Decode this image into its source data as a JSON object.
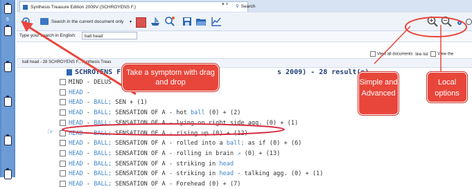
{
  "sidebar": {
    "count": "6"
  },
  "tabs": [
    {
      "label": "Synthesis Treasure Edition 2009V (SCHROYENS F.)",
      "controls": "▾ ×"
    },
    {
      "label": "Search"
    }
  ],
  "toolbar": {
    "search_scope": "Search in the current document only",
    "search_prompt": "Type your search in English:",
    "search_value": "ball head",
    "option_view_all": "View all documents",
    "option_view_list": "line list",
    "option_view_the": "View the"
  },
  "breadcrumb": "ball head - 28  SCHROYENS F., Synthesis Treas",
  "result_header": {
    "prefix": "SCHROYENS F",
    "suffix": "s 2009) - 28 result(s)"
  },
  "results": [
    {
      "parts": [
        [
          "MIND - DELUS",
          ""
        ]
      ]
    },
    {
      "parts": [
        [
          "HEAD",
          "kw"
        ],
        [
          " - ",
          ""
        ]
      ]
    },
    {
      "parts": [
        [
          "HEAD",
          "kw"
        ],
        [
          " - ",
          ""
        ],
        [
          "BALL;",
          "kw"
        ],
        [
          " SEN",
          ""
        ],
        [
          "                        + (1)",
          ""
        ]
      ]
    },
    {
      "parts": [
        [
          "HEAD",
          "kw"
        ],
        [
          " - ",
          ""
        ],
        [
          "BALL;",
          "kw"
        ],
        [
          " SENSATION OF A - hot ",
          ""
        ],
        [
          "ball",
          "kw"
        ],
        [
          " (0)  + (2)",
          ""
        ]
      ]
    },
    {
      "parts": [
        [
          "HEAD",
          "kw"
        ],
        [
          " - ",
          ""
        ],
        [
          "BALL;",
          "kw"
        ],
        [
          " SENSATION OF A - lying on right side agg. (0)  + (1)",
          ""
        ]
      ]
    },
    {
      "parts": [
        [
          "HEAD",
          "kw"
        ],
        [
          " - ",
          ""
        ],
        [
          "BALL;",
          "kw"
        ],
        [
          " SENSATION OF A - rising up (0)  + (12)",
          ""
        ]
      ]
    },
    {
      "parts": [
        [
          "HEAD",
          "kw"
        ],
        [
          " - ",
          ""
        ],
        [
          "BALL;",
          "kw"
        ],
        [
          " SENSATION OF A - rolled into a ",
          ""
        ],
        [
          "ball;",
          "kw"
        ],
        [
          " as if (0)  + (6)",
          ""
        ]
      ]
    },
    {
      "parts": [
        [
          "HEAD",
          "kw"
        ],
        [
          " - ",
          ""
        ],
        [
          "BALL;",
          "kw"
        ],
        [
          " SENSATION OF A - rolling in brain ",
          ""
        ],
        [
          "↗",
          "kw"
        ],
        [
          "  (0)  + (13)",
          ""
        ]
      ]
    },
    {
      "parts": [
        [
          "HEAD",
          "kw"
        ],
        [
          " - ",
          ""
        ],
        [
          "BALL;",
          "kw"
        ],
        [
          " SENSATION OF A - striking in ",
          ""
        ],
        [
          "head",
          "kw"
        ]
      ]
    },
    {
      "parts": [
        [
          "HEAD",
          "kw"
        ],
        [
          " - ",
          ""
        ],
        [
          "BALL;",
          "kw"
        ],
        [
          " SENSATION OF A - striking in ",
          ""
        ],
        [
          "head",
          "kw"
        ],
        [
          " - talking agg. (0)  + (1)",
          ""
        ]
      ]
    },
    {
      "parts": [
        [
          "HEAD",
          "kw"
        ],
        [
          " - ",
          ""
        ],
        [
          "BALL;",
          "kw"
        ],
        [
          " SENSATION OF A - Forehead (0)  + (7)",
          ""
        ]
      ]
    }
  ],
  "callouts": {
    "drag": "Take a symptom with drag and drop",
    "simple": "Simple and Advanced",
    "local": "Local options"
  },
  "colors": {
    "callout": "#e8463b",
    "keyword": "#3f86c9",
    "strip": "#5b8ccb"
  }
}
